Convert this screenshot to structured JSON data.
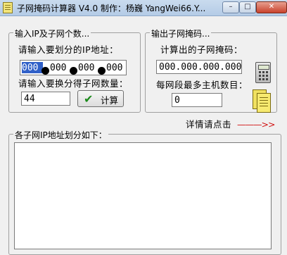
{
  "window": {
    "title": "子网掩码计算器 V4.0  制作：杨巍 YangWei66.Y...",
    "min_glyph": "–",
    "max_glyph": "□",
    "close_glyph": "✕"
  },
  "input_group": {
    "legend": "输入IP及子网个数...",
    "ip_label": "请输入要划分的IP地址：",
    "ip_octets": [
      "000",
      "000",
      "000",
      "000"
    ],
    "subnet_count_label": "请输入要换分得子网数量：",
    "subnet_count_value": "44",
    "calc_button": "计算"
  },
  "output_group": {
    "legend": "输出子网掩码...",
    "mask_label": "计算出的子网掩码：",
    "mask_value": "000.000.000.000",
    "hosts_label": "每网段最多主机数目：",
    "hosts_value": "0"
  },
  "details_link": {
    "text": "详情请点击",
    "arrow": "———>>"
  },
  "result_group": {
    "legend": "各子网IP地址划分如下：",
    "content": ""
  },
  "colors": {
    "accent": "#3060c8",
    "arrow": "#d01010",
    "check": "#1a8a1a"
  },
  "icons": {
    "app": "notepad-icon",
    "calculator": "calculator-icon",
    "notes": "notes-icon",
    "check": "check-icon"
  }
}
